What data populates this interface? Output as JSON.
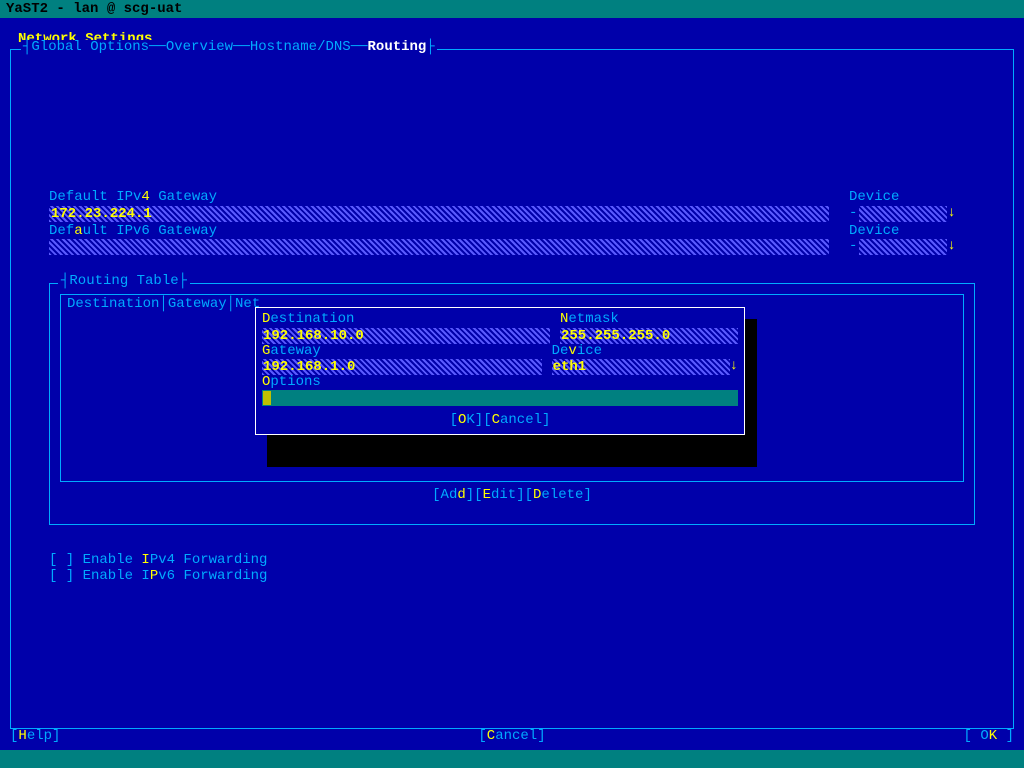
{
  "title": "YaST2 - lan @ scg-uat",
  "heading": "Network Settings",
  "tabs": {
    "global": "Global Options",
    "overview": "Overview",
    "hostname": "Hostname/DNS",
    "routing": "Routing"
  },
  "fields": {
    "ipv4_gateway_label_pre": "Default IPv",
    "ipv4_gateway_label_hl": "4",
    "ipv4_gateway_label_post": " Gateway",
    "ipv4_gateway_value": "172.23.224.1",
    "ipv6_gateway_label_pre": "Def",
    "ipv6_gateway_label_hl": "a",
    "ipv6_gateway_label_post": "ult IPv6 Gateway",
    "ipv6_gateway_value": "",
    "device_label": "Device",
    "device_value_1": "-",
    "device_value_2": "-"
  },
  "routing_table": {
    "title": "Routing Table",
    "columns": "Destination│Gateway│Net",
    "buttons": {
      "add": "Ad",
      "add_hl": "d",
      "edit_hl": "E",
      "edit": "dit",
      "delete_hl": "D",
      "delete": "elete"
    }
  },
  "dialog": {
    "dest_label_hl": "D",
    "dest_label": "estination",
    "dest_value": "192.168.10.0",
    "netmask_label_hl": "N",
    "netmask_label": "etmask",
    "netmask_value": "255.255.255.0",
    "gateway_label_hl": "G",
    "gateway_label": "ateway",
    "gateway_value": "192.168.1.0",
    "device_label_pre": "De",
    "device_label_hl": "v",
    "device_label_post": "ice",
    "device_value": "eth1",
    "options_label_hl": "O",
    "options_label": "ptions",
    "options_value": "",
    "ok": "OK",
    "cancel": "Cancel"
  },
  "checkboxes": {
    "ipv4_fwd_pre": "[ ] Enable ",
    "ipv4_fwd_hl": "I",
    "ipv4_fwd_post": "Pv4 Forwarding",
    "ipv6_fwd_pre": "[ ] Enable I",
    "ipv6_fwd_hl": "P",
    "ipv6_fwd_post": "v6 Forwarding"
  },
  "bottom": {
    "help_hl": "H",
    "help": "elp",
    "cancel_hl": "C",
    "cancel": "ancel",
    "ok_pre": "O",
    "ok_hl": "K"
  }
}
